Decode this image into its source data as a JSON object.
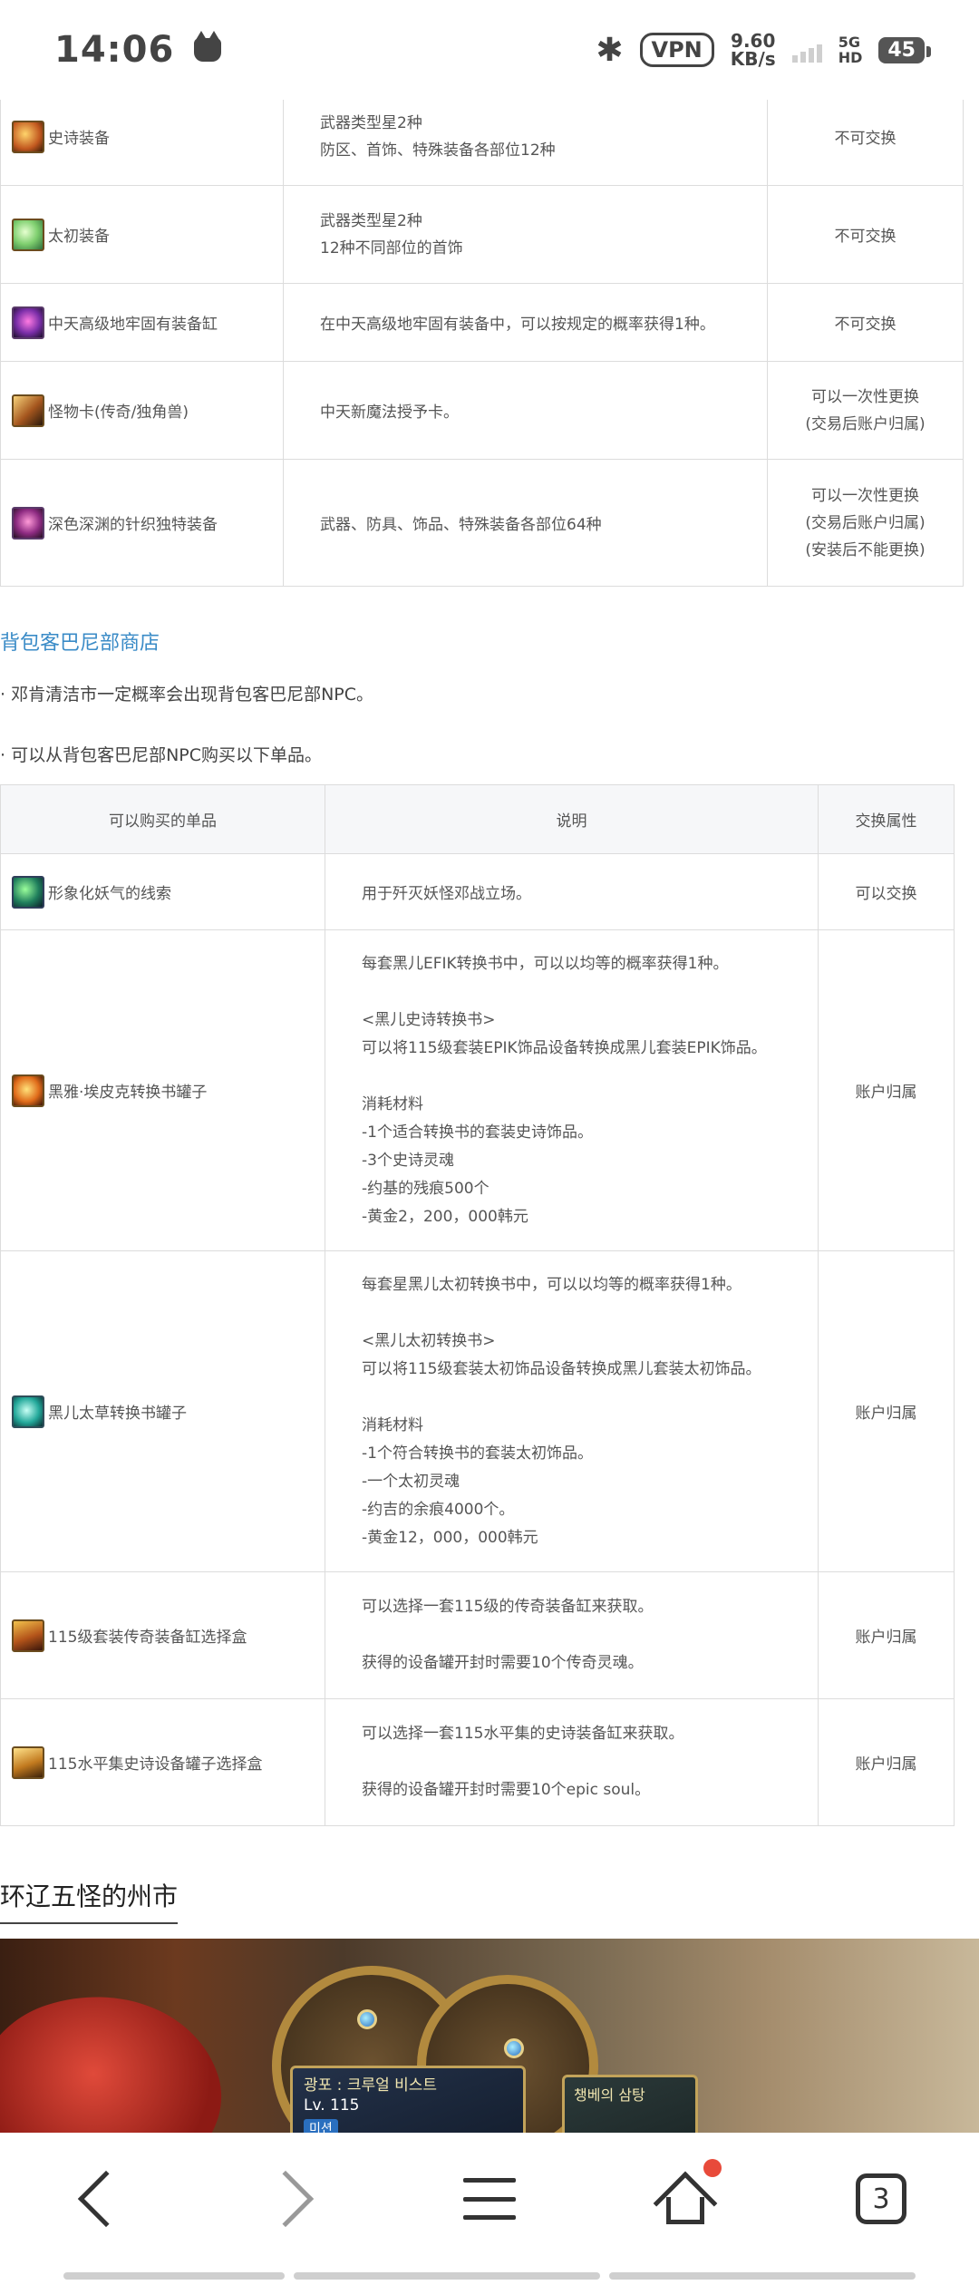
{
  "status_bar": {
    "time": "14:06",
    "bluetooth": "bluetooth-icon",
    "vpn": "VPN",
    "speed_value": "9.60",
    "speed_unit": "KB/s",
    "network_5g": "5G",
    "network_hd": "HD",
    "battery": "45"
  },
  "table1": {
    "rows": [
      {
        "name": "史诗装备",
        "desc": [
          "武器类型星2种",
          "防区、首饰、特殊装备各部位12种"
        ],
        "attr": [
          "不可交换"
        ]
      },
      {
        "name": "太初装备",
        "desc": [
          "武器类型星2种",
          "12种不同部位的首饰"
        ],
        "attr": [
          "不可交换"
        ]
      },
      {
        "name": "中天高级地牢固有装备缸",
        "desc": [
          "在中天高级地牢固有装备中，可以按规定的概率获得1种。"
        ],
        "attr": [
          "不可交换"
        ]
      },
      {
        "name": "怪物卡(传奇/独角兽)",
        "desc": [
          "中天新魔法授予卡。"
        ],
        "attr": [
          "可以一次性更换",
          "(交易后账户归属)"
        ]
      },
      {
        "name": "深色深渊的针织独特装备",
        "desc": [
          "武器、防具、饰品、特殊装备各部位64种"
        ],
        "attr": [
          "可以一次性更换",
          "(交易后账户归属)",
          "(安装后不能更换)"
        ]
      }
    ]
  },
  "shop": {
    "title": "背包客巴尼部商店",
    "bullet1": "· 邓肯清洁市一定概率会出现背包客巴尼部NPC。",
    "bullet2": "· 可以从背包客巴尼部NPC购买以下单品。",
    "headers": {
      "item": "可以购买的单品",
      "desc": "说明",
      "attr": "交换属性"
    },
    "rows": [
      {
        "name": "形象化妖气的线索",
        "desc": [
          "用于歼灭妖怪邓战立场。"
        ],
        "attr": "可以交换"
      },
      {
        "name": "黑雅·埃皮克转换书罐子",
        "desc": [
          "每套黑儿EFIK转换书中，可以以均等的概率获得1种。",
          "",
          "<黑儿史诗转换书>",
          "可以将115级套装EPIK饰品设备转换成黑儿套装EPIK饰品。",
          "",
          "消耗材料",
          "-1个适合转换书的套装史诗饰品。",
          "-3个史诗灵魂",
          "-约基的残痕500个",
          "-黄金2，200，000韩元"
        ],
        "attr": "账户归属"
      },
      {
        "name": "黑儿太草转换书罐子",
        "desc": [
          "每套星黑儿太初转换书中，可以以均等的概率获得1种。",
          "",
          "<黑儿太初转换书>",
          "可以将115级套装太初饰品设备转换成黑儿套装太初饰品。",
          "",
          "消耗材料",
          "-1个符合转换书的套装太初饰品。",
          "-一个太初灵魂",
          "-约吉的余痕4000个。",
          "-黄金12，000，000韩元"
        ],
        "attr": "账户归属"
      },
      {
        "name": "115级套装传奇装备缸选择盒",
        "desc": [
          "可以选择一套115级的传奇装备缸来获取。",
          "",
          "获得的设备罐开封时需要10个传奇灵魂。"
        ],
        "attr": "账户归属"
      },
      {
        "name": "115水平集史诗设备罐子选择盒",
        "desc": [
          "可以选择一套115水平集的史诗装备缸来获取。",
          "",
          "获得的设备罐开封时需要10个epic soul。"
        ],
        "attr": "账户归属"
      }
    ]
  },
  "section2": {
    "title": "环辽五怪的州市"
  },
  "banner": {
    "card_title": "광포 : 크루얼 비스트",
    "card_level": "Lv. 115",
    "card_tag": "미션",
    "card2_title": "챙베의 삼탕"
  },
  "bottom_nav": {
    "tabs_count": "3"
  }
}
